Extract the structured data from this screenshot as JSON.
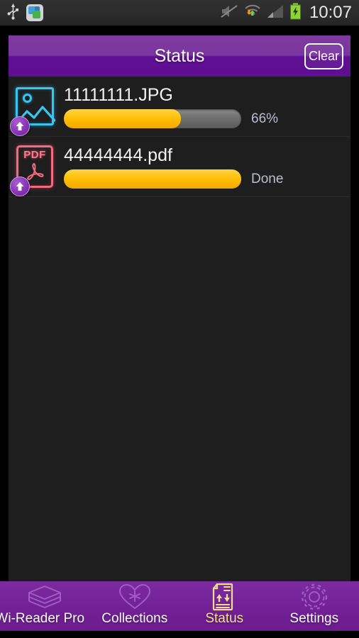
{
  "statusbar": {
    "clock": "10:07",
    "icons": {
      "usb": "usb-icon",
      "app": "app-notification-icon",
      "mute": "volume-mute-icon",
      "wifi": "wifi-transfer-icon",
      "signal": "cell-signal-icon",
      "battery": "battery-charging-icon"
    }
  },
  "header": {
    "title": "Status",
    "clear_label": "Clear"
  },
  "transfers": [
    {
      "filename": "11111111.JPG",
      "filetype": "image",
      "file_icon": "photo-file-icon",
      "badge_icon": "upload-arrow-icon",
      "progress": 66,
      "status_text": "66%"
    },
    {
      "filename": "44444444.pdf",
      "filetype": "pdf",
      "file_icon": "pdf-file-icon",
      "badge_icon": "upload-arrow-icon",
      "progress": 100,
      "status_text": "Done"
    }
  ],
  "nav": {
    "items": [
      {
        "label": "Wi-Reader Pro",
        "icon": "books-stack-icon",
        "active": false
      },
      {
        "label": "Collections",
        "icon": "heart-star-icon",
        "active": false
      },
      {
        "label": "Status",
        "icon": "transfer-document-icon",
        "active": true
      },
      {
        "label": "Settings",
        "icon": "gear-icon",
        "active": false
      }
    ]
  },
  "colors": {
    "header_purple_top": "#7e3a9e",
    "header_purple_bottom": "#5d0f90",
    "nav_purple": "#732196",
    "progress_yellow": "#ffc107",
    "progress_track": "#707070",
    "content_bg": "#1e1e1e",
    "status_text": "#b9bfcc",
    "active_tab": "#f7e389",
    "image_icon": "#35c6f4",
    "pdf_icon": "#f36b7f",
    "badge_purple": "#8a34b8"
  }
}
